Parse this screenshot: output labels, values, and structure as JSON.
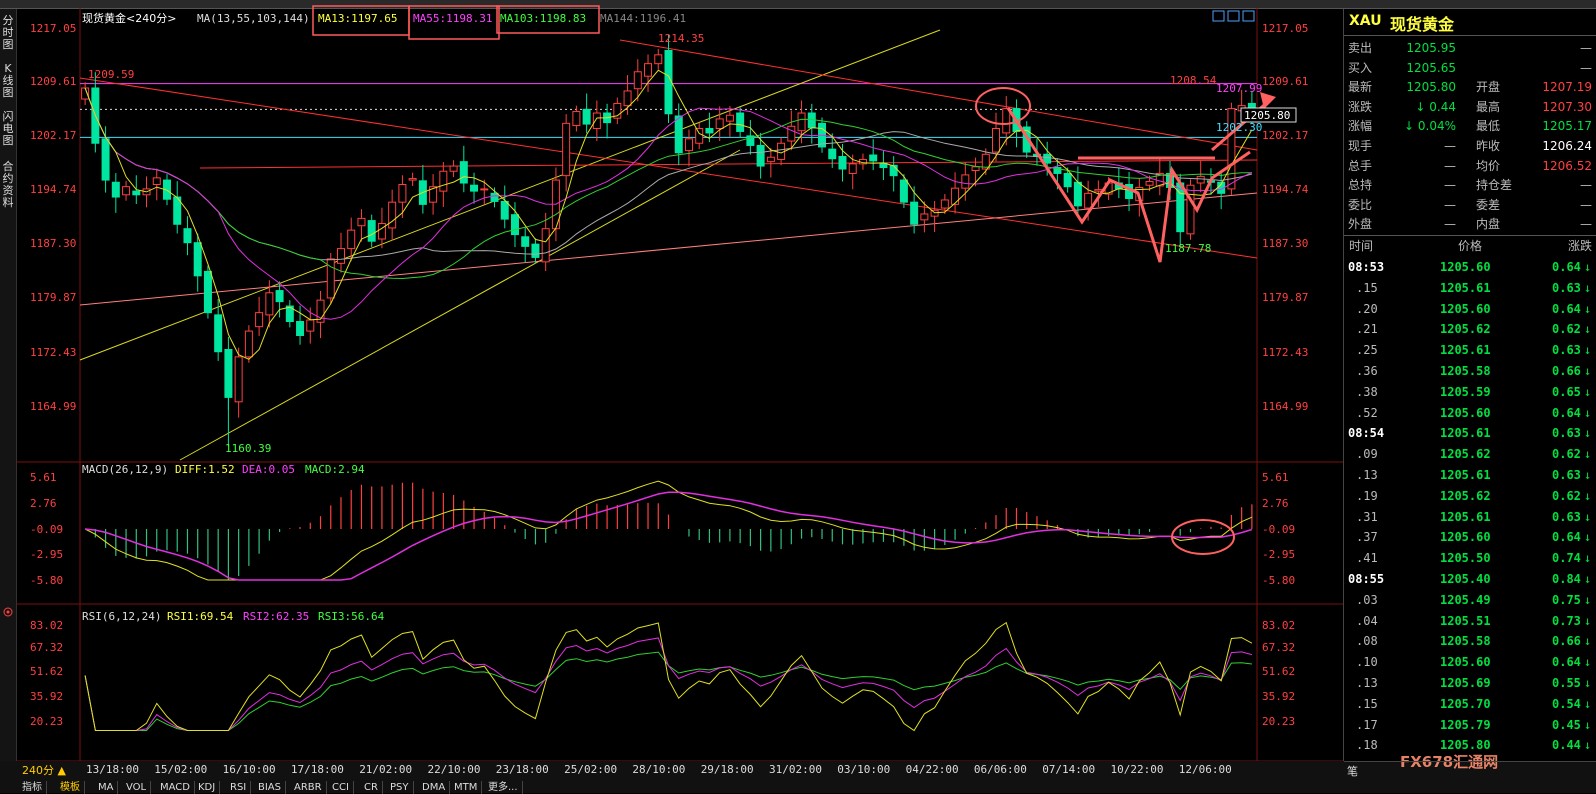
{
  "chart_title": "现货黄金<240分>",
  "ma_legend": {
    "label": "MA(13,55,103,144)",
    "ma13": "MA13:1197.65",
    "ma55": "MA55:1198.31",
    "ma103": "MA103:1198.83",
    "ma144": "MA144:1196.41"
  },
  "price_axis": [
    "1217.05",
    "1209.61",
    "1202.17",
    "1194.74",
    "1187.30",
    "1179.87",
    "1172.43",
    "1164.99"
  ],
  "price_annotations": {
    "high": "1214.35",
    "low": "1160.39",
    "left_level": "1209.59",
    "r1": "1208.54",
    "r2": "1207.99",
    "r3": "1202.30",
    "last": "1205.80",
    "recent_low": "1187.78"
  },
  "macd_legend": {
    "label": "MACD(26,12,9)",
    "diff": "DIFF:1.52",
    "dea": "DEA:0.05",
    "macd": "MACD:2.94"
  },
  "macd_axis": [
    "5.61",
    "2.76",
    "-0.09",
    "-2.95",
    "-5.80"
  ],
  "rsi_legend": {
    "label": "RSI(6,12,24)",
    "rsi1": "RSI1:69.54",
    "rsi2": "RSI2:62.35",
    "rsi3": "RSI3:56.64"
  },
  "rsi_axis": [
    "83.02",
    "67.32",
    "51.62",
    "35.92",
    "20.23"
  ],
  "period": "240分",
  "date_axis": [
    "13/18:00",
    "15/02:00",
    "16/10:00",
    "17/18:00",
    "21/02:00",
    "22/10:00",
    "23/18:00",
    "25/02:00",
    "28/10:00",
    "29/18:00",
    "31/02:00",
    "03/10:00",
    "04/22:00",
    "06/06:00",
    "07/14:00",
    "10/22:00",
    "12/06:00"
  ],
  "left_tabs": [
    "分时图",
    "K线图",
    "闪电图",
    "合约资料"
  ],
  "bottom_tabs": [
    "指标",
    "模板",
    "MA",
    "VOL",
    "MACD",
    "KDJ",
    "RSI",
    "BIAS",
    "ARBR",
    "CCI",
    "CR",
    "PSY",
    "DMA",
    "MTM",
    "更多..."
  ],
  "watermark": "FX678汇通网",
  "quote": {
    "code": "XAU",
    "name": "现货黄金",
    "rows": [
      {
        "l": "卖出",
        "v": "1205.95",
        "l2": "",
        "v2": "—"
      },
      {
        "l": "买入",
        "v": "1205.65",
        "l2": "",
        "v2": "—"
      },
      {
        "l": "最新",
        "v": "1205.80",
        "l2": "开盘",
        "v2": "1207.19"
      },
      {
        "l": "涨跌",
        "v": "↓ 0.44",
        "l2": "最高",
        "v2": "1207.30"
      },
      {
        "l": "涨幅",
        "v": "↓ 0.04%",
        "l2": "最低",
        "v2": "1205.17"
      },
      {
        "l": "现手",
        "v": "—",
        "l2": "昨收",
        "v2": "1206.24"
      },
      {
        "l": "总手",
        "v": "—",
        "l2": "均价",
        "v2": "1206.52"
      },
      {
        "l": "总持",
        "v": "—",
        "l2": "持仓差",
        "v2": "—"
      },
      {
        "l": "委比",
        "v": "—",
        "l2": "委差",
        "v2": "—"
      },
      {
        "l": "外盘",
        "v": "—",
        "l2": "内盘",
        "v2": "—"
      }
    ]
  },
  "trades_header": {
    "time": "时间",
    "price": "价格",
    "chg": "涨跌"
  },
  "trades": [
    {
      "t": "08:53",
      "p": "1205.60",
      "c": "0.64"
    },
    {
      "t": ".15",
      "p": "1205.61",
      "c": "0.63"
    },
    {
      "t": ".20",
      "p": "1205.60",
      "c": "0.64"
    },
    {
      "t": ".21",
      "p": "1205.62",
      "c": "0.62"
    },
    {
      "t": ".25",
      "p": "1205.61",
      "c": "0.63"
    },
    {
      "t": ".36",
      "p": "1205.58",
      "c": "0.66"
    },
    {
      "t": ".38",
      "p": "1205.59",
      "c": "0.65"
    },
    {
      "t": ".52",
      "p": "1205.60",
      "c": "0.64"
    },
    {
      "t": "08:54",
      "p": "1205.61",
      "c": "0.63"
    },
    {
      "t": ".09",
      "p": "1205.62",
      "c": "0.62"
    },
    {
      "t": ".13",
      "p": "1205.61",
      "c": "0.63"
    },
    {
      "t": ".19",
      "p": "1205.62",
      "c": "0.62"
    },
    {
      "t": ".31",
      "p": "1205.61",
      "c": "0.63"
    },
    {
      "t": ".37",
      "p": "1205.60",
      "c": "0.64"
    },
    {
      "t": ".41",
      "p": "1205.50",
      "c": "0.74"
    },
    {
      "t": "08:55",
      "p": "1205.40",
      "c": "0.84"
    },
    {
      "t": ".03",
      "p": "1205.49",
      "c": "0.75"
    },
    {
      "t": ".04",
      "p": "1205.51",
      "c": "0.73"
    },
    {
      "t": ".08",
      "p": "1205.58",
      "c": "0.66"
    },
    {
      "t": ".10",
      "p": "1205.60",
      "c": "0.64"
    },
    {
      "t": ".13",
      "p": "1205.69",
      "c": "0.55"
    },
    {
      "t": ".15",
      "p": "1205.70",
      "c": "0.54"
    },
    {
      "t": ".17",
      "p": "1205.79",
      "c": "0.45"
    },
    {
      "t": ".18",
      "p": "1205.80",
      "c": "0.44"
    }
  ],
  "right_bottom_tab": "笔",
  "chart_data": {
    "type": "candlestick",
    "symbol": "XAU",
    "timeframe": "240分",
    "closes": [
      1209.0,
      1201.5,
      1196.5,
      1194.2,
      1195.6,
      1194.5,
      1195.3,
      1196.8,
      1193.9,
      1190.5,
      1188.0,
      1183.5,
      1178.5,
      1173.2,
      1167.0,
      1172.5,
      1176.0,
      1178.5,
      1181.2,
      1180.0,
      1177.3,
      1175.4,
      1177.5,
      1180.2,
      1185.8,
      1187.2,
      1189.7,
      1191.3,
      1188.2,
      1190.6,
      1193.5,
      1195.9,
      1196.7,
      1193.2,
      1195.6,
      1197.7,
      1198.4,
      1196.1,
      1195.0,
      1195.3,
      1193.6,
      1191.2,
      1189.1,
      1187.5,
      1186.0,
      1189.9,
      1196.5,
      1204.2,
      1205.8,
      1204.1,
      1205.6,
      1204.3,
      1206.9,
      1208.6,
      1211.2,
      1212.3,
      1213.5,
      1205.5,
      1200.2,
      1202.1,
      1203.5,
      1202.9,
      1204.8,
      1205.3,
      1203.1,
      1201.2,
      1198.4,
      1199.6,
      1201.5,
      1203.8,
      1205.6,
      1203.6,
      1201.0,
      1199.4,
      1198.0,
      1198.7,
      1199.3,
      1199.1,
      1198.2,
      1197.1,
      1193.5,
      1190.5,
      1191.9,
      1192.4,
      1193.8,
      1195.4,
      1197.2,
      1198.3,
      1200.0,
      1203.5,
      1206.2,
      1203.1,
      1200.3,
      1199.7,
      1198.8,
      1197.4,
      1195.6,
      1193.0,
      1194.7,
      1195.2,
      1196.1,
      1195.3,
      1194.0,
      1195.5,
      1196.3,
      1197.4,
      1195.5,
      1189.5,
      1195.8,
      1197.0,
      1196.2,
      1194.7,
      1206.2,
      1206.6,
      1205.8
    ]
  }
}
